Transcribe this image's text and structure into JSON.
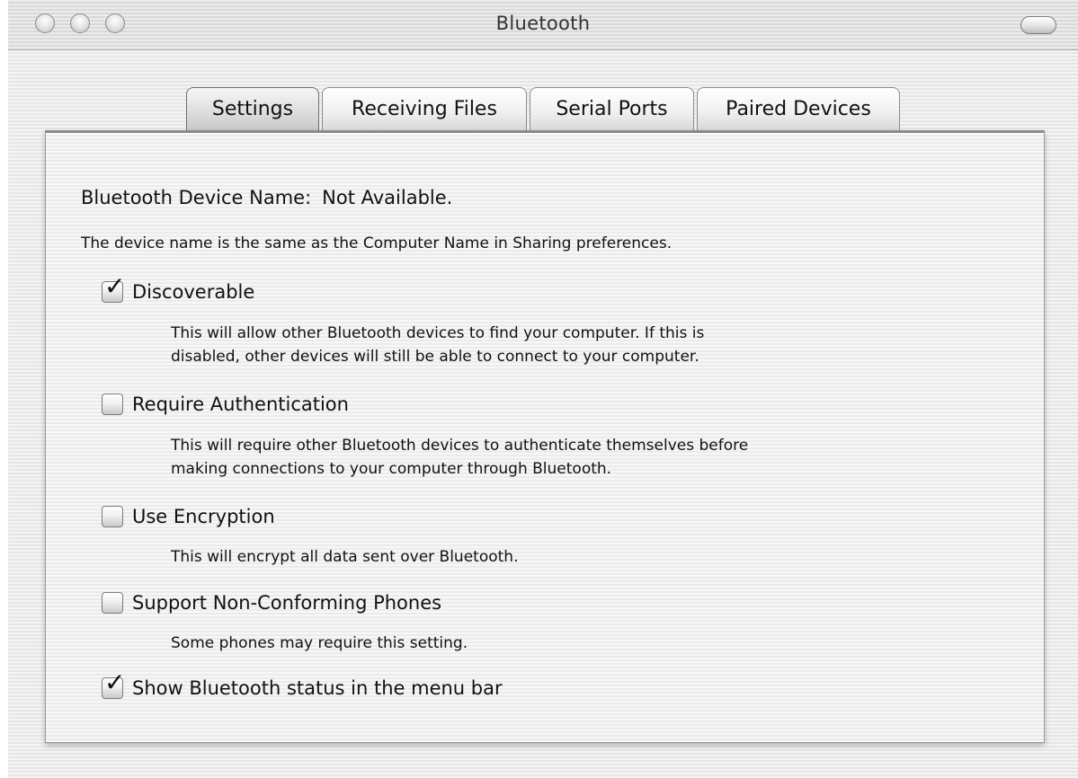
{
  "window": {
    "title": "Bluetooth"
  },
  "tabs": [
    {
      "label": "Settings",
      "active": true
    },
    {
      "label": "Receiving Files",
      "active": false
    },
    {
      "label": "Serial Ports",
      "active": false
    },
    {
      "label": "Paired Devices",
      "active": false
    }
  ],
  "settings": {
    "device_name_label": "Bluetooth Device Name:",
    "device_name_value": "Not Available.",
    "device_name_note": "The device name is the same as the Computer Name in Sharing preferences.",
    "options": [
      {
        "label": "Discoverable",
        "checked": true,
        "description_lines": [
          "This will allow other Bluetooth devices to find your computer.  If this is",
          "disabled, other devices will still be able to connect to your computer."
        ]
      },
      {
        "label": "Require Authentication",
        "checked": false,
        "description_lines": [
          "This will require other Bluetooth devices to authenticate themselves before",
          "making connections to your computer through Bluetooth."
        ]
      },
      {
        "label": "Use Encryption",
        "checked": false,
        "description_lines": [
          "This will encrypt all data sent over Bluetooth."
        ]
      },
      {
        "label": "Support Non-Conforming Phones",
        "checked": false,
        "description_lines": [
          "Some phones may require this setting."
        ]
      },
      {
        "label": "Show Bluetooth status in the menu bar",
        "checked": true,
        "description_lines": []
      }
    ]
  },
  "icons": {
    "close": "close-button-icon",
    "minimize": "minimize-button-icon",
    "zoom": "zoom-button-icon",
    "toolbar_toggle": "toolbar-toggle-icon",
    "checkmark": "checkmark-icon"
  }
}
